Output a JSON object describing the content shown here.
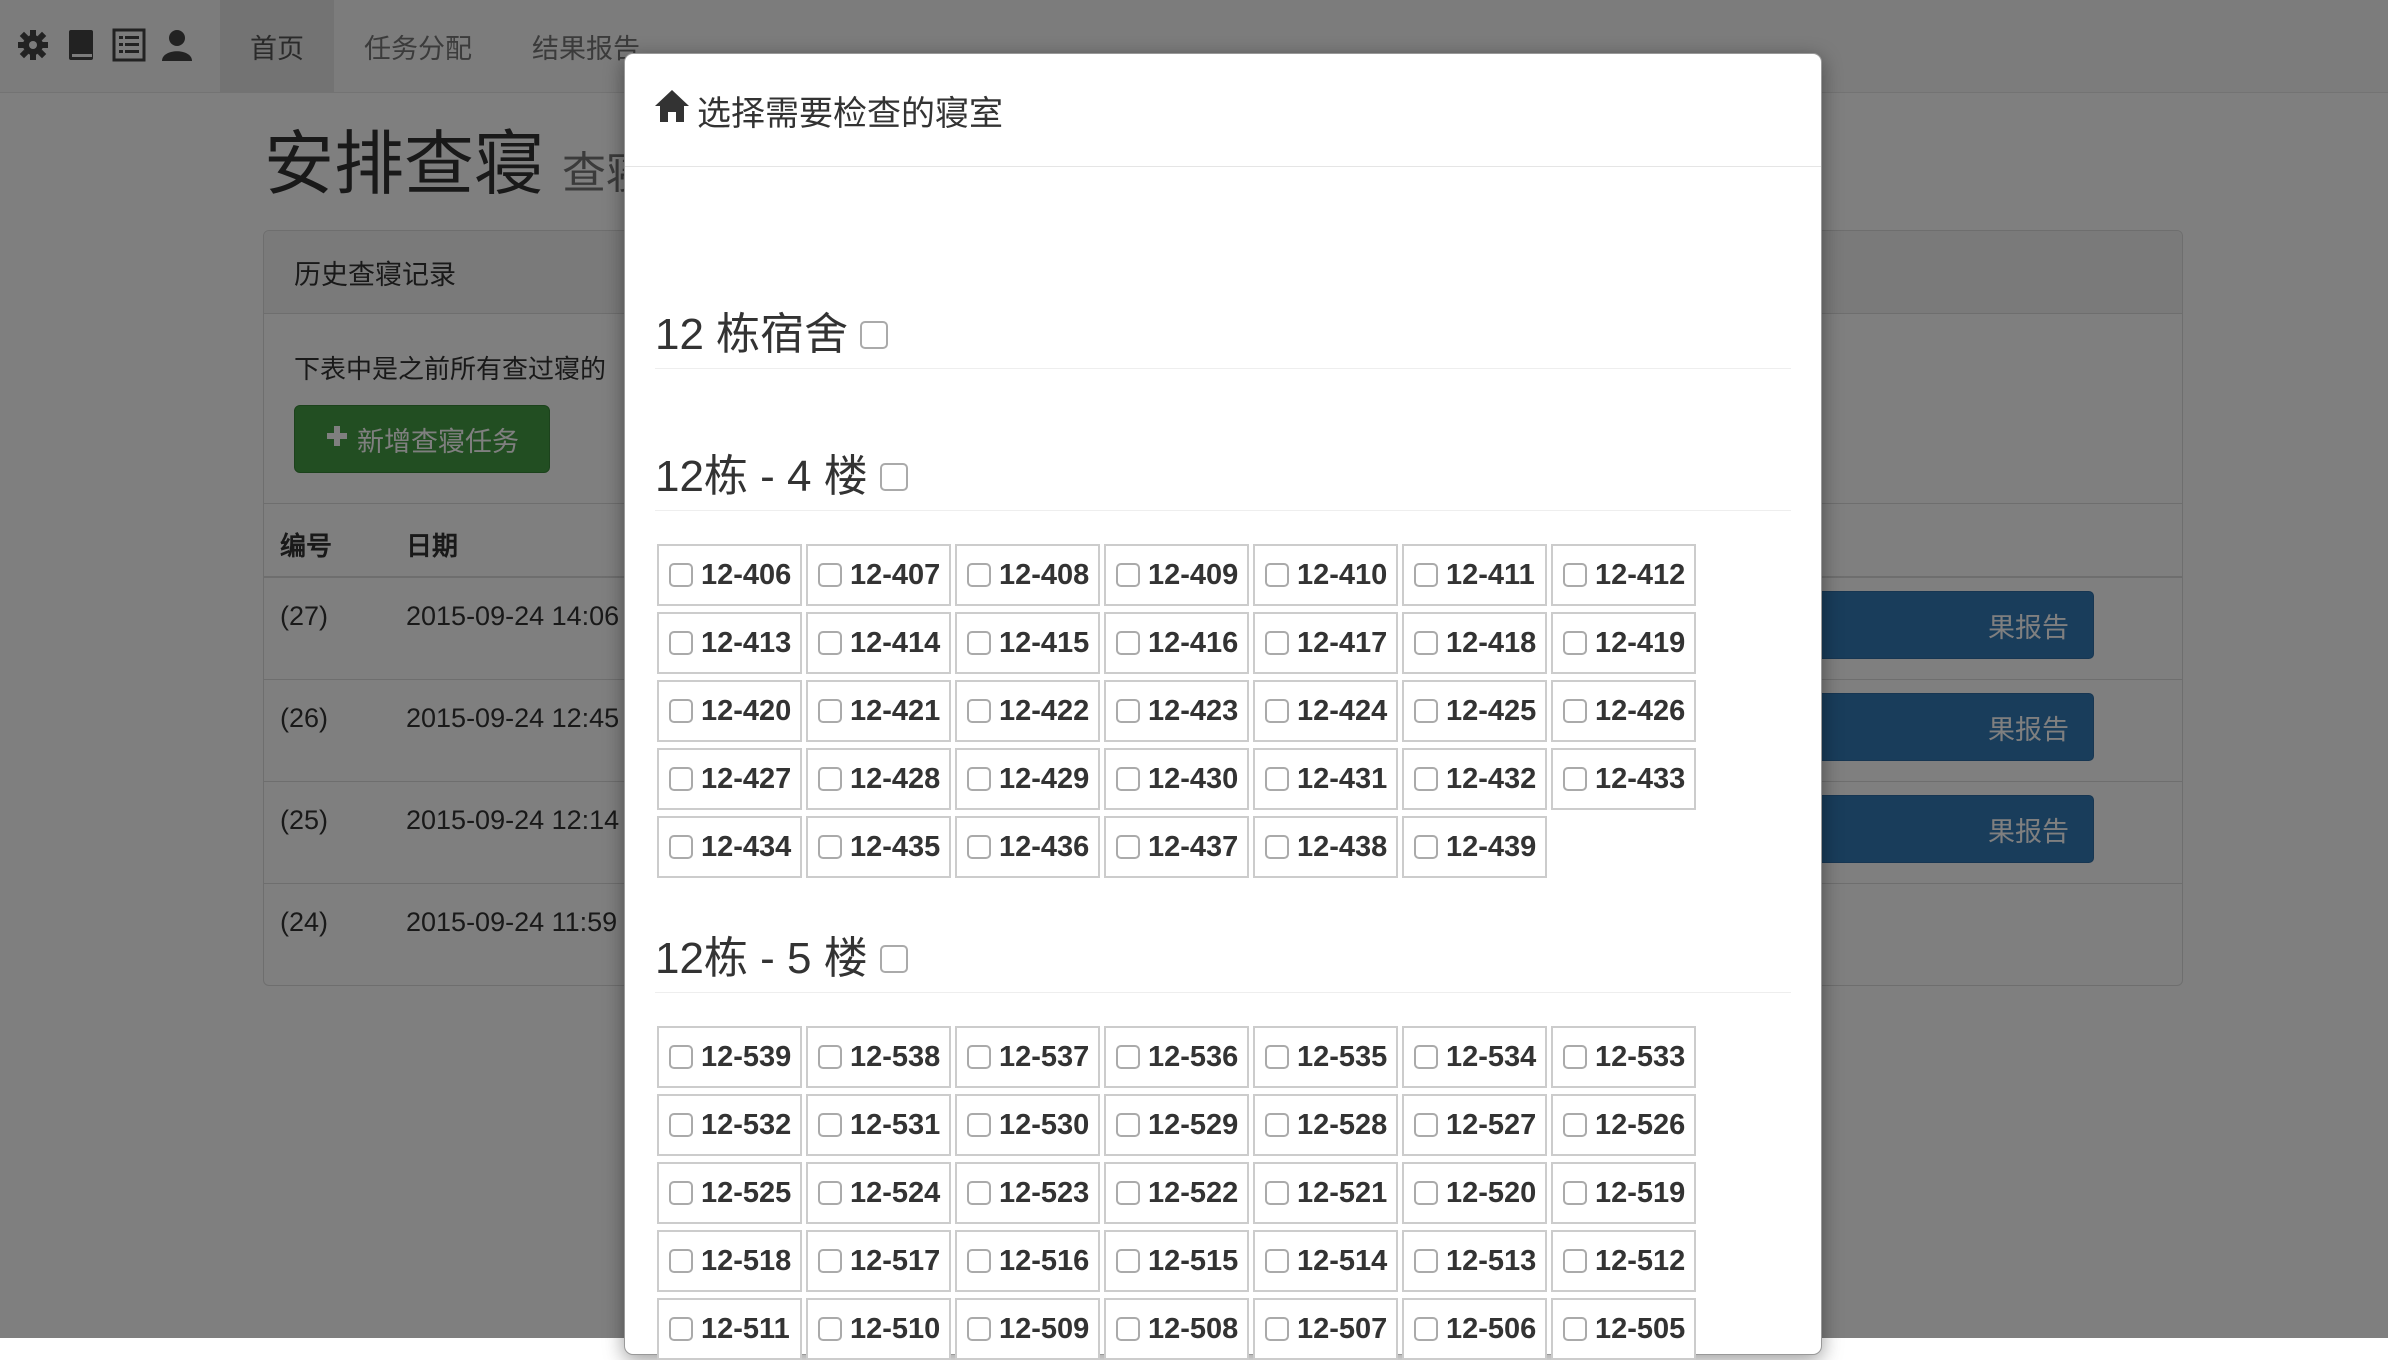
{
  "nav": {
    "icons": [
      "gear-icon",
      "book-icon",
      "list-icon",
      "user-icon"
    ],
    "tabs": [
      {
        "label": "首页",
        "active": true
      },
      {
        "label": "任务分配",
        "active": false
      },
      {
        "label": "结果报告",
        "active": false
      }
    ]
  },
  "page": {
    "title": "安排查寝",
    "subtitle": "查寝"
  },
  "panel": {
    "heading": "历史查寝记录",
    "description": "下表中是之前所有查过寝的",
    "add_button": "新增查寝任务",
    "columns": [
      "编号",
      "日期"
    ],
    "rows": [
      {
        "id": "(27)",
        "date": "2015-09-24 14:06",
        "report": "果报告"
      },
      {
        "id": "(26)",
        "date": "2015-09-24 12:45",
        "report": "果报告"
      },
      {
        "id": "(25)",
        "date": "2015-09-24 12:14",
        "report": "果报告"
      },
      {
        "id": "(24)",
        "date": "2015-09-24 11:59",
        "report": ""
      }
    ]
  },
  "modal": {
    "title": "选择需要检查的寝室",
    "building": "12 栋宿舍",
    "floors": [
      {
        "label": "12栋 - 4 楼",
        "rooms": [
          "12-406",
          "12-407",
          "12-408",
          "12-409",
          "12-410",
          "12-411",
          "12-412",
          "12-413",
          "12-414",
          "12-415",
          "12-416",
          "12-417",
          "12-418",
          "12-419",
          "12-420",
          "12-421",
          "12-422",
          "12-423",
          "12-424",
          "12-425",
          "12-426",
          "12-427",
          "12-428",
          "12-429",
          "12-430",
          "12-431",
          "12-432",
          "12-433",
          "12-434",
          "12-435",
          "12-436",
          "12-437",
          "12-438",
          "12-439"
        ]
      },
      {
        "label": "12栋 - 5 楼",
        "rooms": [
          "12-539",
          "12-538",
          "12-537",
          "12-536",
          "12-535",
          "12-534",
          "12-533",
          "12-532",
          "12-531",
          "12-530",
          "12-529",
          "12-528",
          "12-527",
          "12-526",
          "12-525",
          "12-524",
          "12-523",
          "12-522",
          "12-521",
          "12-520",
          "12-519",
          "12-518",
          "12-517",
          "12-516",
          "12-515",
          "12-514",
          "12-513",
          "12-512",
          "12-511",
          "12-510",
          "12-509",
          "12-508",
          "12-507",
          "12-506",
          "12-505"
        ]
      }
    ]
  }
}
